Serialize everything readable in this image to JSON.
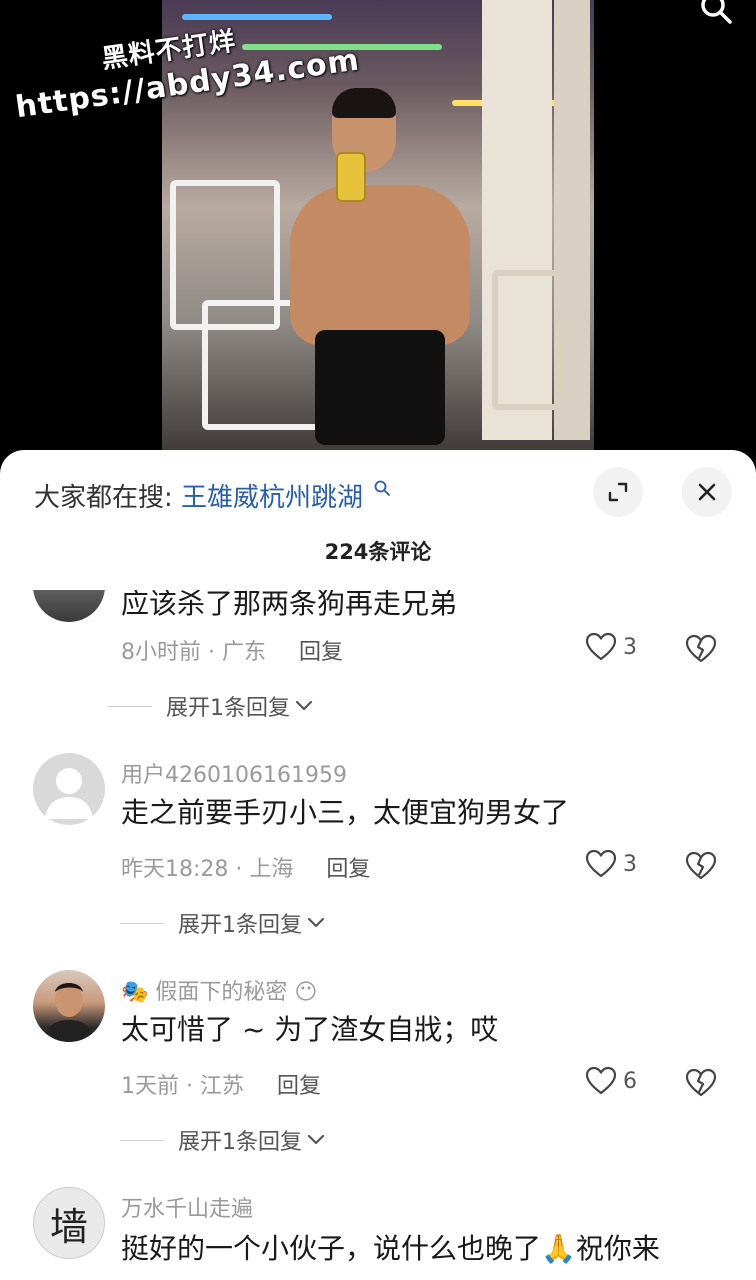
{
  "watermark": {
    "line1": "黑料不打烊",
    "line2": "https://abdy34.com"
  },
  "sheet": {
    "hot_search_label": "大家都在搜:",
    "hot_search_term": "王雄威杭州跳湖",
    "comment_count_title": "224条评论"
  },
  "comments": [
    {
      "username": "",
      "text": "应该杀了那两条狗再走兄弟",
      "time": "8小时前",
      "location": "广东",
      "reply_label": "回复",
      "likes": "3",
      "expand_label": "展开1条回复"
    },
    {
      "username": "用户4260106161959",
      "text": "走之前要手刃小三，太便宜狗男女了",
      "time": "昨天18:28",
      "location": "上海",
      "reply_label": "回复",
      "likes": "3",
      "expand_label": "展开1条回复"
    },
    {
      "username": "假面下的秘密",
      "username_emoji_left": "🎭",
      "username_emoji_right": "😶",
      "text": "太可惜了 ~ 为了渣女自戕；哎",
      "time": "1天前",
      "location": "江苏",
      "reply_label": "回复",
      "likes": "6",
      "expand_label": "展开1条回复"
    },
    {
      "username": "万水千山走遍",
      "avatar_char": "墙",
      "text": "挺好的一个小伙子，说什么也晚了",
      "text_emoji": "🙏",
      "text_tail": "祝你来",
      "time": "",
      "location": "",
      "reply_label": "",
      "likes": ""
    }
  ],
  "meta_separator": "·",
  "icons": {
    "search": "search-icon",
    "expand": "expand-icon",
    "close": "close-icon",
    "like": "heart-icon",
    "dislike": "broken-heart-icon",
    "chevron": "chevron-down-icon"
  },
  "colors": {
    "link_blue": "#2a5ea8",
    "muted_text": "#9a9a9a",
    "sheet_bg": "#ffffff",
    "button_bg": "#f2f2f2"
  }
}
